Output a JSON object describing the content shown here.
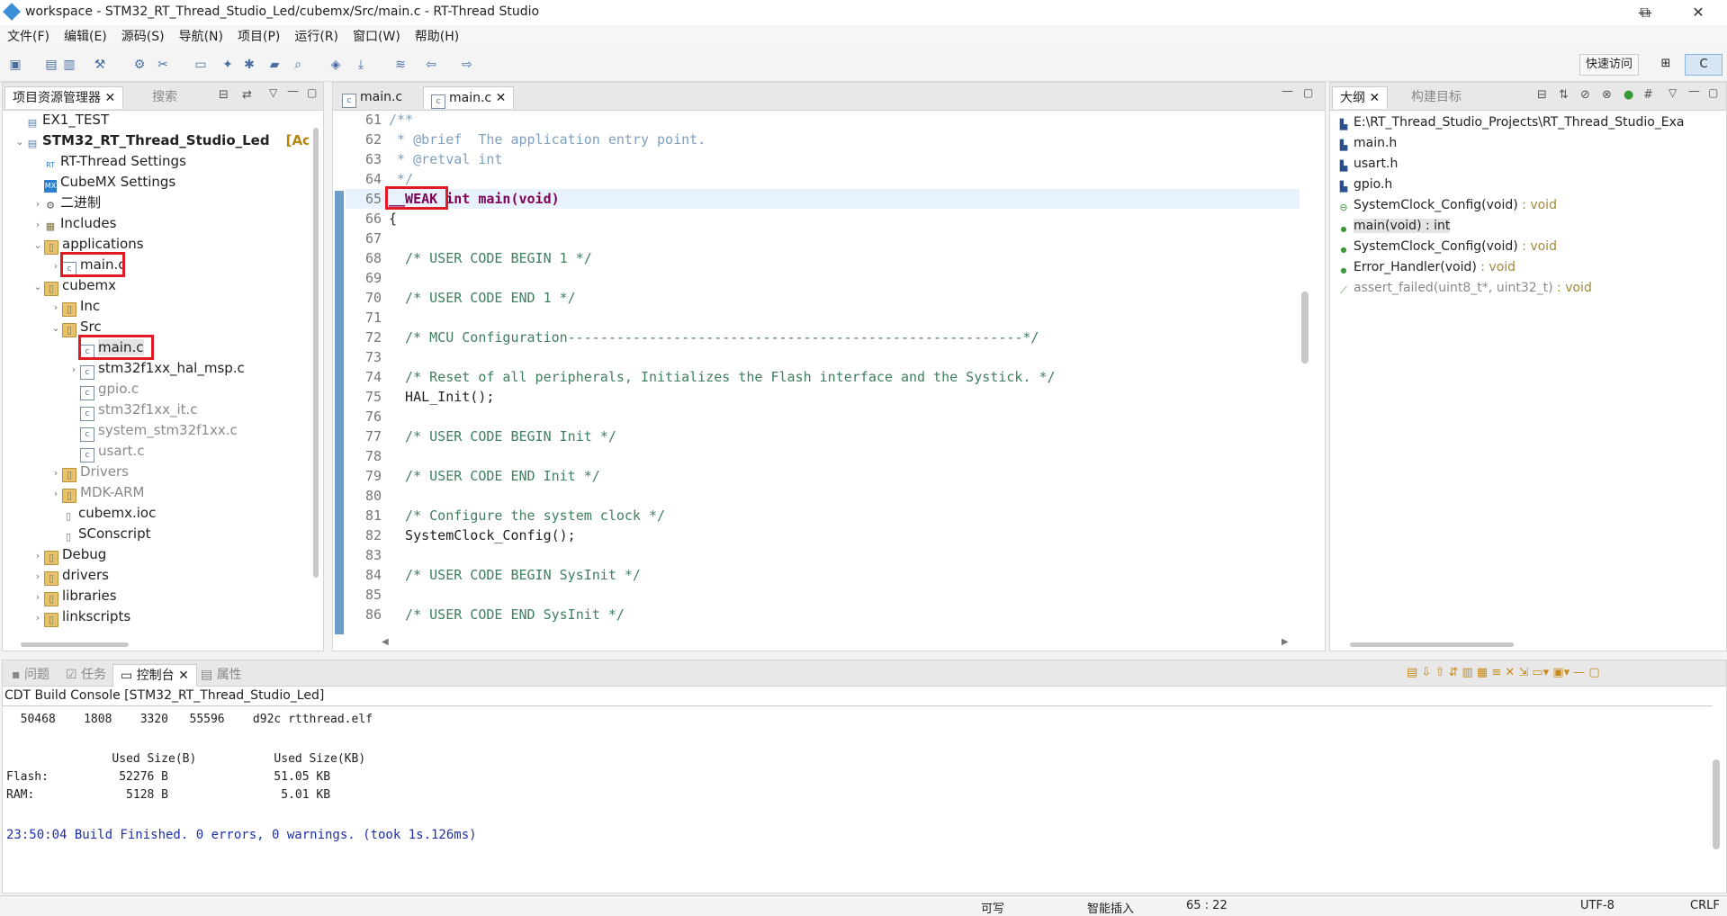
{
  "window": {
    "title": "workspace - STM32_RT_Thread_Studio_Led/cubemx/Src/main.c - RT-Thread Studio",
    "minimize": "—",
    "restore": "⧉",
    "close": "✕"
  },
  "menu": [
    "文件(F)",
    "编辑(E)",
    "源码(S)",
    "导航(N)",
    "项目(P)",
    "运行(R)",
    "窗口(W)",
    "帮助(H)"
  ],
  "toolbar": {
    "quick_access": "快速访问",
    "perspective_label": "C"
  },
  "project_explorer": {
    "tabs": [
      "项目资源管理器",
      "搜索"
    ],
    "items": [
      {
        "label": "EX1_TEST",
        "level": 0,
        "icon": "project-icon",
        "arrow": ""
      },
      {
        "label": "STM32_RT_Thread_Studio_Led",
        "suffix": "[Activ",
        "level": 0,
        "icon": "project-icon",
        "arrow": "v",
        "bold": true
      },
      {
        "label": "RT-Thread Settings",
        "level": 1,
        "icon": "rt-settings-icon",
        "arrow": ""
      },
      {
        "label": "CubeMX Settings",
        "level": 1,
        "icon": "cubemx-icon",
        "arrow": ""
      },
      {
        "label": "二进制",
        "level": 1,
        "icon": "binary-icon",
        "arrow": ">"
      },
      {
        "label": "Includes",
        "level": 1,
        "icon": "includes-icon",
        "arrow": ">"
      },
      {
        "label": "applications",
        "level": 1,
        "icon": "folder-icon",
        "arrow": "v"
      },
      {
        "label": "main.c",
        "level": 2,
        "icon": "c-file-icon",
        "arrow": ">",
        "boxed": true
      },
      {
        "label": "cubemx",
        "level": 1,
        "icon": "folder-icon",
        "arrow": "v"
      },
      {
        "label": "Inc",
        "level": 2,
        "icon": "folder-icon",
        "arrow": ">"
      },
      {
        "label": "Src",
        "level": 2,
        "icon": "folder-icon",
        "arrow": "v"
      },
      {
        "label": "main.c",
        "level": 3,
        "icon": "c-file-icon",
        "arrow": "",
        "boxed": true,
        "selected": true
      },
      {
        "label": "stm32f1xx_hal_msp.c",
        "level": 3,
        "icon": "c-file-icon",
        "arrow": ">"
      },
      {
        "label": "gpio.c",
        "level": 3,
        "icon": "c-file-excluded-icon",
        "arrow": "",
        "greyed": true
      },
      {
        "label": "stm32f1xx_it.c",
        "level": 3,
        "icon": "c-file-excluded-icon",
        "arrow": "",
        "greyed": true
      },
      {
        "label": "system_stm32f1xx.c",
        "level": 3,
        "icon": "c-file-excluded-icon",
        "arrow": "",
        "greyed": true
      },
      {
        "label": "usart.c",
        "level": 3,
        "icon": "c-file-excluded-icon",
        "arrow": "",
        "greyed": true
      },
      {
        "label": "Drivers",
        "level": 2,
        "icon": "folder-icon",
        "arrow": ">",
        "greyed": true
      },
      {
        "label": "MDK-ARM",
        "level": 2,
        "icon": "folder-icon",
        "arrow": ">",
        "greyed": true
      },
      {
        "label": "cubemx.ioc",
        "level": 2,
        "icon": "file-icon",
        "arrow": ""
      },
      {
        "label": "SConscript",
        "level": 2,
        "icon": "file-icon",
        "arrow": ""
      },
      {
        "label": "Debug",
        "level": 1,
        "icon": "folder-icon",
        "arrow": ">"
      },
      {
        "label": "drivers",
        "level": 1,
        "icon": "folder-icon",
        "arrow": ">"
      },
      {
        "label": "libraries",
        "level": 1,
        "icon": "folder-icon",
        "arrow": ">"
      },
      {
        "label": "linkscripts",
        "level": 1,
        "icon": "folder-icon",
        "arrow": ">"
      }
    ]
  },
  "editor": {
    "tabs": [
      {
        "label": "main.c",
        "active": false
      },
      {
        "label": "main.c",
        "active": true
      }
    ],
    "lines": [
      {
        "n": "61",
        "text": "/**",
        "kind": "comment"
      },
      {
        "n": "62",
        "text": " * @brief  The application entry point.",
        "kind": "comment"
      },
      {
        "n": "63",
        "text": " * @retval int",
        "kind": "comment"
      },
      {
        "n": "64",
        "text": " */",
        "kind": "comment"
      },
      {
        "n": "65",
        "text": "__WEAK int main(void)",
        "kind": "code",
        "highlight": true
      },
      {
        "n": "66",
        "text": "{",
        "kind": "code"
      },
      {
        "n": "67",
        "text": "",
        "kind": "code"
      },
      {
        "n": "68",
        "text": "  /* USER CODE BEGIN 1 */",
        "kind": "comment"
      },
      {
        "n": "69",
        "text": "",
        "kind": "code"
      },
      {
        "n": "70",
        "text": "  /* USER CODE END 1 */",
        "kind": "comment"
      },
      {
        "n": "71",
        "text": "",
        "kind": "code"
      },
      {
        "n": "72",
        "text": "  /* MCU Configuration--------------------------------------------------------*/",
        "kind": "comment"
      },
      {
        "n": "73",
        "text": "",
        "kind": "code"
      },
      {
        "n": "74",
        "text": "  /* Reset of all peripherals, Initializes the Flash interface and the Systick. */",
        "kind": "comment"
      },
      {
        "n": "75",
        "text": "  HAL_Init();",
        "kind": "code"
      },
      {
        "n": "76",
        "text": "",
        "kind": "code"
      },
      {
        "n": "77",
        "text": "  /* USER CODE BEGIN Init */",
        "kind": "comment"
      },
      {
        "n": "78",
        "text": "",
        "kind": "code"
      },
      {
        "n": "79",
        "text": "  /* USER CODE END Init */",
        "kind": "comment"
      },
      {
        "n": "80",
        "text": "",
        "kind": "code"
      },
      {
        "n": "81",
        "text": "  /* Configure the system clock */",
        "kind": "comment"
      },
      {
        "n": "82",
        "text": "  SystemClock_Config();",
        "kind": "code"
      },
      {
        "n": "83",
        "text": "",
        "kind": "code"
      },
      {
        "n": "84",
        "text": "  /* USER CODE BEGIN SysInit */",
        "kind": "comment"
      },
      {
        "n": "85",
        "text": "",
        "kind": "code"
      },
      {
        "n": "86",
        "text": "  /* USER CODE END SysInit */",
        "kind": "comment"
      }
    ]
  },
  "outline": {
    "tabs": [
      "大纲",
      "构建目标"
    ],
    "items": [
      {
        "label": "E:\\RT_Thread_Studio_Projects\\RT_Thread_Studio_Exa",
        "type": "",
        "icon": "include-icon"
      },
      {
        "label": "main.h",
        "type": "",
        "icon": "include-icon"
      },
      {
        "label": "usart.h",
        "type": "",
        "icon": "include-icon"
      },
      {
        "label": "gpio.h",
        "type": "",
        "icon": "include-icon"
      },
      {
        "label": "SystemClock_Config(void)",
        "type": " : void",
        "icon": "declaration-icon"
      },
      {
        "label": "main(void) : int",
        "type": "",
        "icon": "function-icon",
        "selected": true
      },
      {
        "label": "SystemClock_Config(void)",
        "type": " : void",
        "icon": "function-icon"
      },
      {
        "label": "Error_Handler(void)",
        "type": " : void",
        "icon": "function-icon"
      },
      {
        "label": "assert_failed(uint8_t*, uint32_t)",
        "type": " : void",
        "icon": "function-disabled-icon",
        "greyed": true
      }
    ]
  },
  "bottom": {
    "tabs": [
      "问题",
      "任务",
      "控制台",
      "属性"
    ],
    "console_title": "CDT Build Console [STM32_RT_Thread_Studio_Led]",
    "lines": [
      "  50468    1808    3320   55596    d92c rtthread.elf",
      "",
      "               Used Size(B)           Used Size(KB)",
      "Flash:          52276 B               51.05 KB",
      "RAM:             5128 B                5.01 KB",
      ""
    ],
    "finish_line": "23:50:04 Build Finished. 0 errors, 0 warnings. (took 1s.126ms)"
  },
  "status": {
    "writable": "可写",
    "insert_mode": "智能插入",
    "position": "65 : 22",
    "encoding": "UTF-8",
    "line_ending": "CRLF"
  },
  "colors": {
    "highlight_box": "#e01b24",
    "keyword": "#7f0055",
    "comment": "#3f7f5f",
    "console_finish": "#1e2fa8"
  }
}
